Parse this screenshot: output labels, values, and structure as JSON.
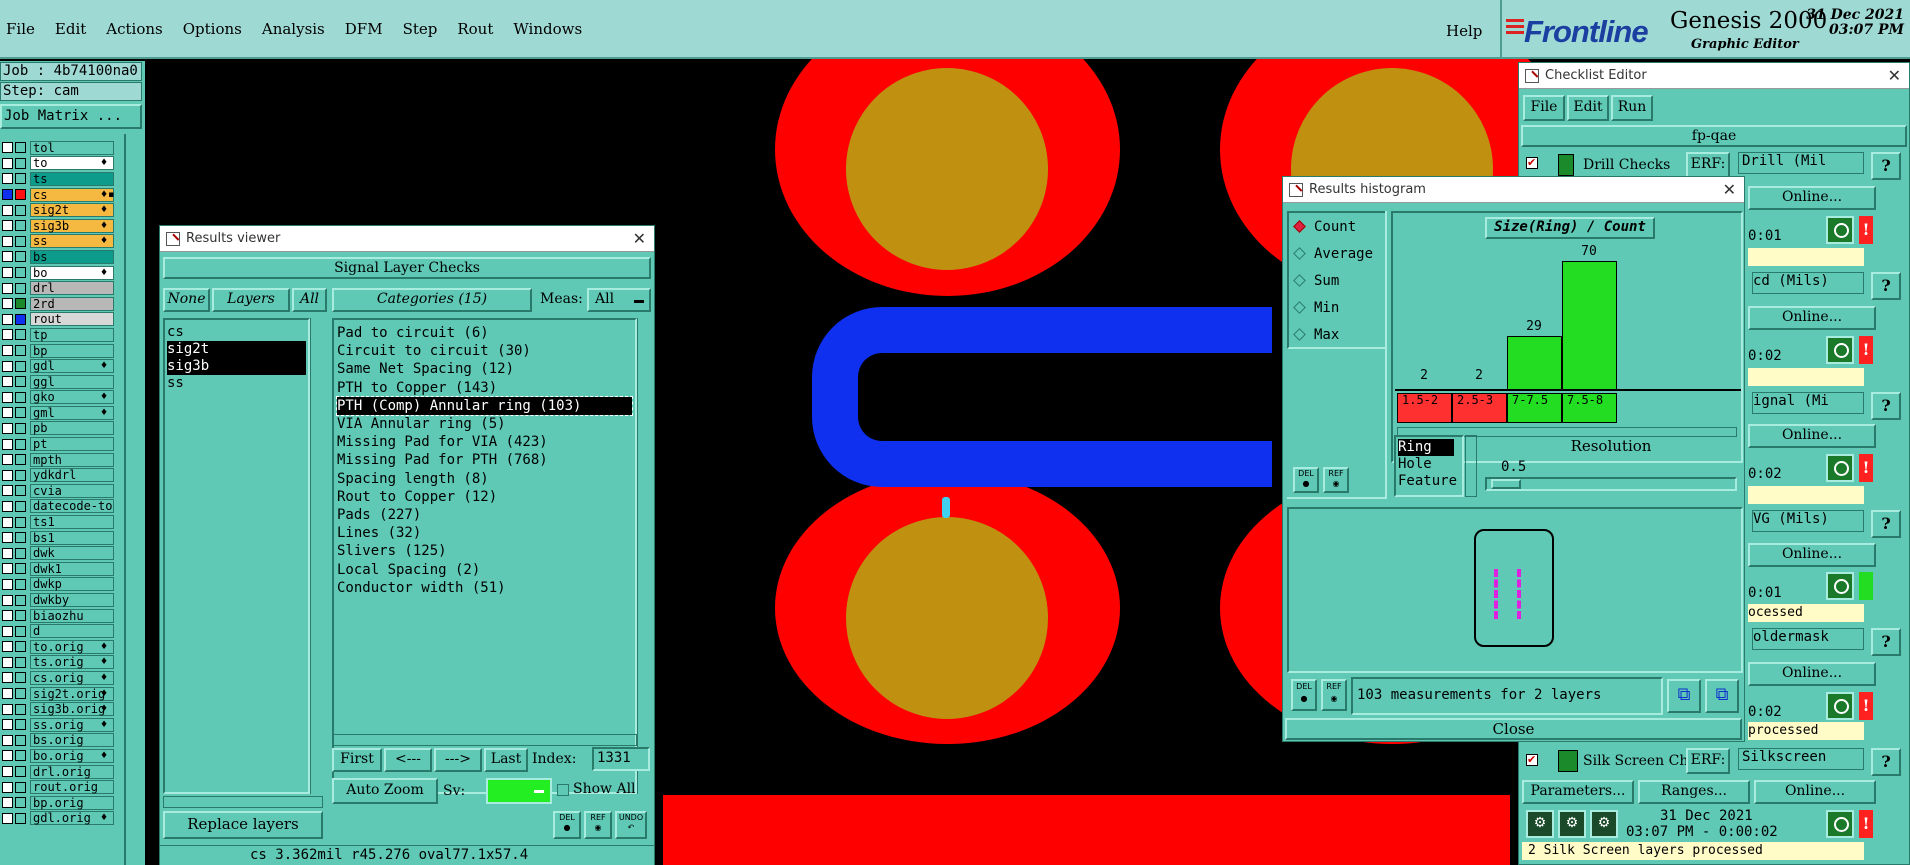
{
  "menu": {
    "items": [
      "File",
      "Edit",
      "Actions",
      "Options",
      "Analysis",
      "DFM",
      "Step",
      "Rout",
      "Windows"
    ],
    "help": "Help"
  },
  "brand": {
    "logo": "Frontline",
    "product": "Genesis 2000",
    "subtitle": "Graphic Editor",
    "date": "31 Dec 2021",
    "time": "03:07 PM"
  },
  "left": {
    "job": "Job : 4b74100na0",
    "step": "Step: cam",
    "job_matrix": "Job Matrix ...",
    "layers": [
      {
        "name": "tol",
        "color": "#5fc9b5"
      },
      {
        "name": "to",
        "color": "#ffffff",
        "mark": "♦"
      },
      {
        "name": "ts",
        "color": "#0d9c8c"
      },
      {
        "name": "cs",
        "color": "#f5b942",
        "mark": "♦▪"
      },
      {
        "name": "sig2t",
        "color": "#f5b942",
        "mark": "♦"
      },
      {
        "name": "sig3b",
        "color": "#f5b942",
        "mark": "♦"
      },
      {
        "name": "ss",
        "color": "#f5b942",
        "mark": "♦"
      },
      {
        "name": "bs",
        "color": "#0d9c8c"
      },
      {
        "name": "bo",
        "color": "#ffffff",
        "mark": "♦"
      },
      {
        "name": "drl",
        "color": "#b8b8b8"
      },
      {
        "name": "2rd",
        "color": "#b8b8b8"
      },
      {
        "name": "rout",
        "color": "#d8d8d8"
      },
      {
        "name": "tp",
        "color": "#5fc9b5"
      },
      {
        "name": "bp",
        "color": "#5fc9b5"
      },
      {
        "name": "gdl",
        "color": "#5fc9b5",
        "mark": "♦"
      },
      {
        "name": "ggl",
        "color": "#5fc9b5"
      },
      {
        "name": "gko",
        "color": "#5fc9b5",
        "mark": "♦"
      },
      {
        "name": "gml",
        "color": "#5fc9b5",
        "mark": "♦"
      },
      {
        "name": "pb",
        "color": "#5fc9b5"
      },
      {
        "name": "pt",
        "color": "#5fc9b5"
      },
      {
        "name": "mpth",
        "color": "#5fc9b5"
      },
      {
        "name": "ydkdrl",
        "color": "#5fc9b5"
      },
      {
        "name": "cvia",
        "color": "#5fc9b5"
      },
      {
        "name": "datecode-to",
        "color": "#5fc9b5"
      },
      {
        "name": "ts1",
        "color": "#5fc9b5"
      },
      {
        "name": "bs1",
        "color": "#5fc9b5"
      },
      {
        "name": "dwk",
        "color": "#5fc9b5"
      },
      {
        "name": "dwk1",
        "color": "#5fc9b5"
      },
      {
        "name": "dwkp",
        "color": "#5fc9b5"
      },
      {
        "name": "dwkby",
        "color": "#5fc9b5"
      },
      {
        "name": "biaozhu",
        "color": "#5fc9b5"
      },
      {
        "name": "d",
        "color": "#5fc9b5"
      },
      {
        "name": "to.orig",
        "color": "#5fc9b5",
        "mark": "♦"
      },
      {
        "name": "ts.orig",
        "color": "#5fc9b5",
        "mark": "♦"
      },
      {
        "name": "cs.orig",
        "color": "#5fc9b5",
        "mark": "♦"
      },
      {
        "name": "sig2t.orig",
        "color": "#5fc9b5",
        "mark": "♦"
      },
      {
        "name": "sig3b.orig",
        "color": "#5fc9b5",
        "mark": "♦"
      },
      {
        "name": "ss.orig",
        "color": "#5fc9b5",
        "mark": "♦"
      },
      {
        "name": "bs.orig",
        "color": "#5fc9b5"
      },
      {
        "name": "bo.orig",
        "color": "#5fc9b5",
        "mark": "♦"
      },
      {
        "name": "drl.orig",
        "color": "#5fc9b5"
      },
      {
        "name": "rout.orig",
        "color": "#5fc9b5"
      },
      {
        "name": "bp.orig",
        "color": "#5fc9b5"
      },
      {
        "name": "gdl.orig",
        "color": "#5fc9b5",
        "mark": "♦"
      }
    ]
  },
  "results_viewer": {
    "title": "Results viewer",
    "header": "Signal Layer Checks",
    "btn_none": "None",
    "btn_layers": "Layers",
    "btn_all": "All",
    "categories_label": "Categories (15)",
    "meas_label": "Meas:",
    "meas_value": "All",
    "layers": [
      "cs",
      "sig2t",
      "sig3b",
      "ss"
    ],
    "categories": [
      "Pad to circuit (6)",
      "Circuit to circuit (30)",
      "Same Net Spacing (12)",
      "PTH to Copper (143)",
      "PTH (Comp) Annular ring (103)",
      "VIA Annular ring (5)",
      "Missing Pad for VIA (423)",
      "Missing Pad for PTH (768)",
      "Spacing length (8)",
      "Rout to Copper (12)",
      "Pads (227)",
      "Lines (32)",
      "Slivers (125)",
      "Local Spacing (2)",
      "Conductor width (51)"
    ],
    "nav_first": "First",
    "nav_prev": "<---",
    "nav_next": "--->",
    "nav_last": "Last",
    "index_label": "Index:",
    "index_value": "1331",
    "auto_zoom": "Auto Zoom",
    "sv_label": "Sv:",
    "show_all": "Show All",
    "replace_layers": "Replace layers",
    "del": "DEL",
    "ref": "REF",
    "undo": "UNDO",
    "status": "cs 3.362mil  r45.276  oval77.1x57.4"
  },
  "histogram": {
    "title": "Results histogram",
    "modes": [
      "Count",
      "Average",
      "Sum",
      "Min",
      "Max"
    ],
    "chart_title": "Size(Ring) / Count",
    "size_options": [
      "Ring",
      "Hole",
      "Feature"
    ],
    "resolution_label": "Resolution",
    "resolution_value": "0.5",
    "summary": "103 measurements for 2 layers",
    "close": "Close",
    "del": "DEL",
    "ref": "REF"
  },
  "chart_data": {
    "type": "bar",
    "title": "Size(Ring) / Count",
    "categories": [
      "1.5-2",
      "2.5-3",
      "7-7.5",
      "7.5-8"
    ],
    "values": [
      2,
      2,
      29,
      70
    ],
    "ylim": [
      0,
      70
    ]
  },
  "checklist": {
    "title": "Checklist Editor",
    "menu": [
      "File",
      "Edit",
      "Run"
    ],
    "name": "fp-qae",
    "drill_checks": "Drill Checks",
    "erf_label": "ERF:",
    "drill_erf": "Drill (Mil",
    "online": "Online...",
    "q": "?",
    "t1": "0:01",
    "erf2": "cd (Mils)",
    "t2": "0:02",
    "erf3": "ignal (Mi",
    "t3": "0:02",
    "erf4": "VG (Mils)",
    "t4": "0:01",
    "processed1": "ocessed",
    "erf5": "oldermask",
    "t5": "0:02",
    "processed2": "processed",
    "silk": "Silk Screen Che",
    "silk_erf": "Silkscreen",
    "parameters": "Parameters...",
    "ranges": "Ranges...",
    "silk_date": "31 Dec 2021",
    "silk_time": "03:07 PM - 0:00:02",
    "silk_processed": "2 Silk Screen layers processed",
    "bang": "!"
  }
}
